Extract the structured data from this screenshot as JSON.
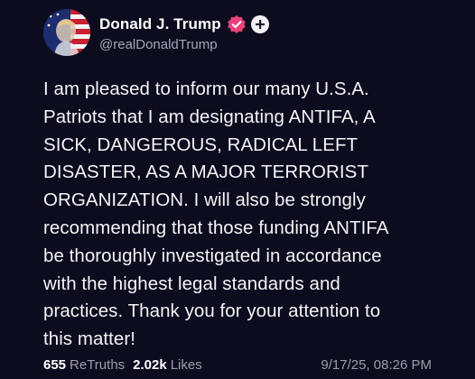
{
  "post": {
    "author": {
      "display_name": "Donald J. Trump",
      "handle": "@realDonaldTrump",
      "avatar_icon": "profile-photo",
      "verified_icon": "verified-badge-icon",
      "verified_color": "#e8437a",
      "follow_icon": "plus-icon"
    },
    "text": "I am pleased to inform our many U.S.A.\nPatriots that I am designating ANTIFA, A\nSICK, DANGEROUS, RADICAL LEFT\nDISASTER, AS A MAJOR TERRORIST\nORGANIZATION. I will also be strongly\nrecommending that those funding ANTIFA\nbe thoroughly investigated in accordance\nwith the highest legal standards and\npractices. Thank you for your attention to\nthis matter!",
    "stats": {
      "retruths_count": "655",
      "retruths_label": "ReTruths",
      "likes_count": "2.02k",
      "likes_label": "Likes"
    },
    "timestamp": "9/17/25, 08:26 PM"
  },
  "colors": {
    "background": "#0d0b1e",
    "text": "#f4f4f7",
    "muted": "#9c9cb0"
  }
}
